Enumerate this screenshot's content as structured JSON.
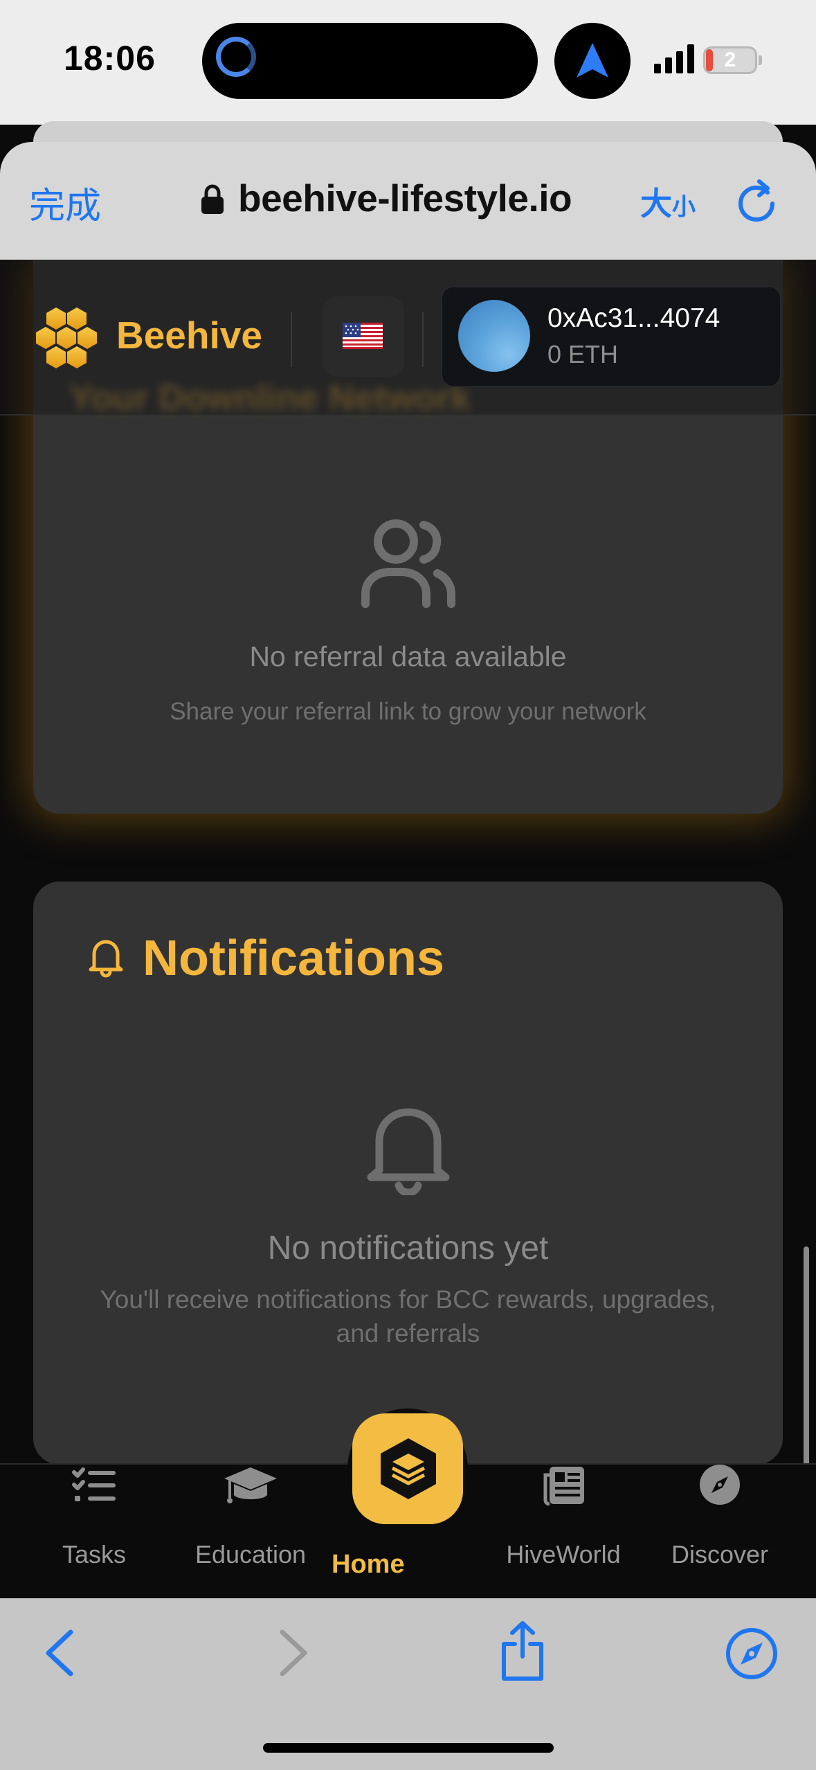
{
  "status_bar": {
    "time": "18:06",
    "battery": "2"
  },
  "browser": {
    "done_label": "完成",
    "url": "beehive-lifestyle.io",
    "size_label_big": "大",
    "size_label_small": "小"
  },
  "header": {
    "brand": "Beehive",
    "wallet": {
      "address": "0xAc31...4074",
      "balance": "0 ETH"
    }
  },
  "referral_card": {
    "title": "Your Downline Network",
    "empty_title": "No referral data available",
    "empty_hint": "Share your referral link to grow your network"
  },
  "notifications_card": {
    "title": "Notifications",
    "empty_title": "No notifications yet",
    "empty_hint": "You'll receive notifications for BCC rewards, upgrades, and referrals"
  },
  "tabs": [
    {
      "label": "Tasks",
      "icon": "tasks-icon"
    },
    {
      "label": "Education",
      "icon": "graduation-cap-icon"
    },
    {
      "label": "Home",
      "icon": "hexagon-layers-icon",
      "active": true
    },
    {
      "label": "HiveWorld",
      "icon": "newspaper-icon"
    },
    {
      "label": "Discover",
      "icon": "compass-icon"
    }
  ],
  "colors": {
    "accent": "#f2bd42",
    "card": "#333333",
    "background": "#0b0b0c",
    "ios_blue": "#1f76ef"
  }
}
